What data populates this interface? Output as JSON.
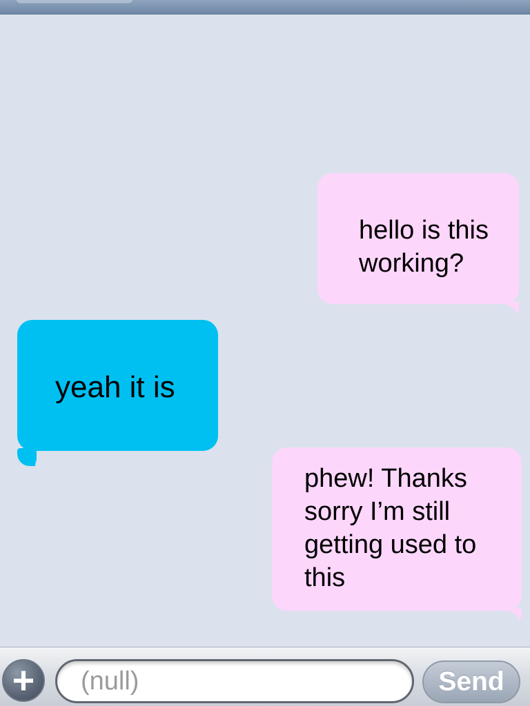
{
  "colors": {
    "background": "#dbe2ed",
    "outgoing_bubble": "#fdd6fb",
    "incoming_bubble": "#00c0f2",
    "top_bar": "#7f94b1"
  },
  "conversation": {
    "messages": [
      {
        "direction": "outgoing",
        "text": "hello is this\nworking?"
      },
      {
        "direction": "incoming",
        "text": "yeah it is"
      },
      {
        "direction": "outgoing",
        "text": "phew! Thanks\nsorry I’m still\ngetting used to\nthis"
      }
    ]
  },
  "composer": {
    "input_placeholder": "(null)",
    "send_label": "Send",
    "plus_icon": "plus-icon"
  }
}
